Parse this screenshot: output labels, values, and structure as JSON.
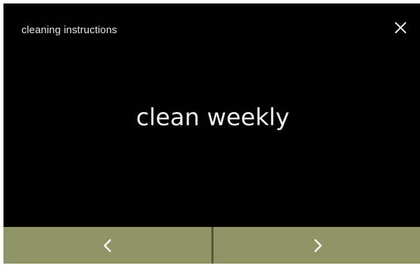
{
  "header": {
    "title": "cleaning instructions",
    "close_icon": "close-icon"
  },
  "main": {
    "message": "clean weekly"
  },
  "footer": {
    "prev_icon": "chevron-left-icon",
    "next_icon": "chevron-right-icon"
  },
  "colors": {
    "screen_background": "#000000",
    "nav_button": "#8f9464",
    "text": "#f0f0f0"
  }
}
